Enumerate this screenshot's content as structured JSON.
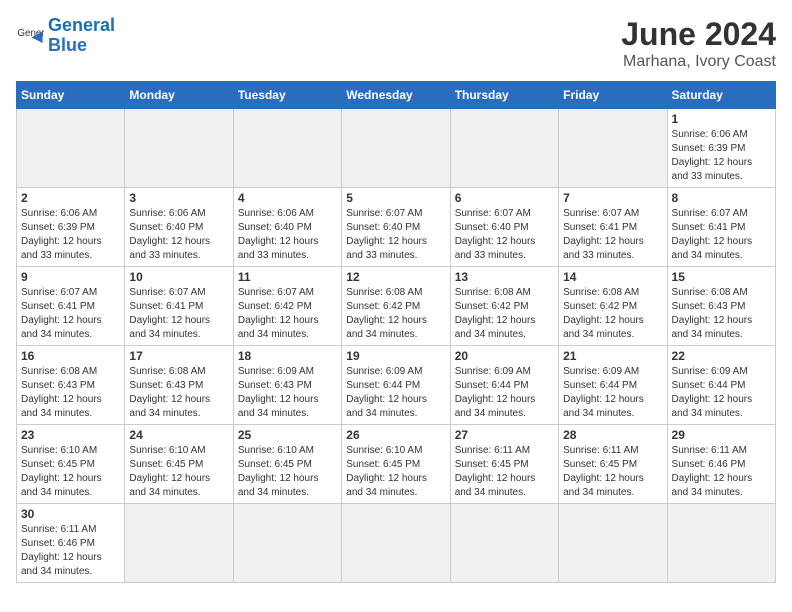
{
  "header": {
    "logo_general": "General",
    "logo_blue": "Blue",
    "title": "June 2024",
    "subtitle": "Marhana, Ivory Coast"
  },
  "weekdays": [
    "Sunday",
    "Monday",
    "Tuesday",
    "Wednesday",
    "Thursday",
    "Friday",
    "Saturday"
  ],
  "weeks": [
    [
      {
        "day": "",
        "empty": true
      },
      {
        "day": "",
        "empty": true
      },
      {
        "day": "",
        "empty": true
      },
      {
        "day": "",
        "empty": true
      },
      {
        "day": "",
        "empty": true
      },
      {
        "day": "",
        "empty": true
      },
      {
        "day": "1",
        "sunrise": "6:06 AM",
        "sunset": "6:39 PM",
        "daylight": "12 hours and 33 minutes."
      }
    ],
    [
      {
        "day": "2",
        "sunrise": "6:06 AM",
        "sunset": "6:39 PM",
        "daylight": "12 hours and 33 minutes."
      },
      {
        "day": "3",
        "sunrise": "6:06 AM",
        "sunset": "6:40 PM",
        "daylight": "12 hours and 33 minutes."
      },
      {
        "day": "4",
        "sunrise": "6:06 AM",
        "sunset": "6:40 PM",
        "daylight": "12 hours and 33 minutes."
      },
      {
        "day": "5",
        "sunrise": "6:07 AM",
        "sunset": "6:40 PM",
        "daylight": "12 hours and 33 minutes."
      },
      {
        "day": "6",
        "sunrise": "6:07 AM",
        "sunset": "6:40 PM",
        "daylight": "12 hours and 33 minutes."
      },
      {
        "day": "7",
        "sunrise": "6:07 AM",
        "sunset": "6:41 PM",
        "daylight": "12 hours and 33 minutes."
      },
      {
        "day": "8",
        "sunrise": "6:07 AM",
        "sunset": "6:41 PM",
        "daylight": "12 hours and 34 minutes."
      }
    ],
    [
      {
        "day": "9",
        "sunrise": "6:07 AM",
        "sunset": "6:41 PM",
        "daylight": "12 hours and 34 minutes."
      },
      {
        "day": "10",
        "sunrise": "6:07 AM",
        "sunset": "6:41 PM",
        "daylight": "12 hours and 34 minutes."
      },
      {
        "day": "11",
        "sunrise": "6:07 AM",
        "sunset": "6:42 PM",
        "daylight": "12 hours and 34 minutes."
      },
      {
        "day": "12",
        "sunrise": "6:08 AM",
        "sunset": "6:42 PM",
        "daylight": "12 hours and 34 minutes."
      },
      {
        "day": "13",
        "sunrise": "6:08 AM",
        "sunset": "6:42 PM",
        "daylight": "12 hours and 34 minutes."
      },
      {
        "day": "14",
        "sunrise": "6:08 AM",
        "sunset": "6:42 PM",
        "daylight": "12 hours and 34 minutes."
      },
      {
        "day": "15",
        "sunrise": "6:08 AM",
        "sunset": "6:43 PM",
        "daylight": "12 hours and 34 minutes."
      }
    ],
    [
      {
        "day": "16",
        "sunrise": "6:08 AM",
        "sunset": "6:43 PM",
        "daylight": "12 hours and 34 minutes."
      },
      {
        "day": "17",
        "sunrise": "6:08 AM",
        "sunset": "6:43 PM",
        "daylight": "12 hours and 34 minutes."
      },
      {
        "day": "18",
        "sunrise": "6:09 AM",
        "sunset": "6:43 PM",
        "daylight": "12 hours and 34 minutes."
      },
      {
        "day": "19",
        "sunrise": "6:09 AM",
        "sunset": "6:44 PM",
        "daylight": "12 hours and 34 minutes."
      },
      {
        "day": "20",
        "sunrise": "6:09 AM",
        "sunset": "6:44 PM",
        "daylight": "12 hours and 34 minutes."
      },
      {
        "day": "21",
        "sunrise": "6:09 AM",
        "sunset": "6:44 PM",
        "daylight": "12 hours and 34 minutes."
      },
      {
        "day": "22",
        "sunrise": "6:09 AM",
        "sunset": "6:44 PM",
        "daylight": "12 hours and 34 minutes."
      }
    ],
    [
      {
        "day": "23",
        "sunrise": "6:10 AM",
        "sunset": "6:45 PM",
        "daylight": "12 hours and 34 minutes."
      },
      {
        "day": "24",
        "sunrise": "6:10 AM",
        "sunset": "6:45 PM",
        "daylight": "12 hours and 34 minutes."
      },
      {
        "day": "25",
        "sunrise": "6:10 AM",
        "sunset": "6:45 PM",
        "daylight": "12 hours and 34 minutes."
      },
      {
        "day": "26",
        "sunrise": "6:10 AM",
        "sunset": "6:45 PM",
        "daylight": "12 hours and 34 minutes."
      },
      {
        "day": "27",
        "sunrise": "6:11 AM",
        "sunset": "6:45 PM",
        "daylight": "12 hours and 34 minutes."
      },
      {
        "day": "28",
        "sunrise": "6:11 AM",
        "sunset": "6:45 PM",
        "daylight": "12 hours and 34 minutes."
      },
      {
        "day": "29",
        "sunrise": "6:11 AM",
        "sunset": "6:46 PM",
        "daylight": "12 hours and 34 minutes."
      }
    ],
    [
      {
        "day": "30",
        "sunrise": "6:11 AM",
        "sunset": "6:46 PM",
        "daylight": "12 hours and 34 minutes."
      },
      {
        "day": "",
        "empty": true
      },
      {
        "day": "",
        "empty": true
      },
      {
        "day": "",
        "empty": true
      },
      {
        "day": "",
        "empty": true
      },
      {
        "day": "",
        "empty": true
      },
      {
        "day": "",
        "empty": true
      }
    ]
  ]
}
